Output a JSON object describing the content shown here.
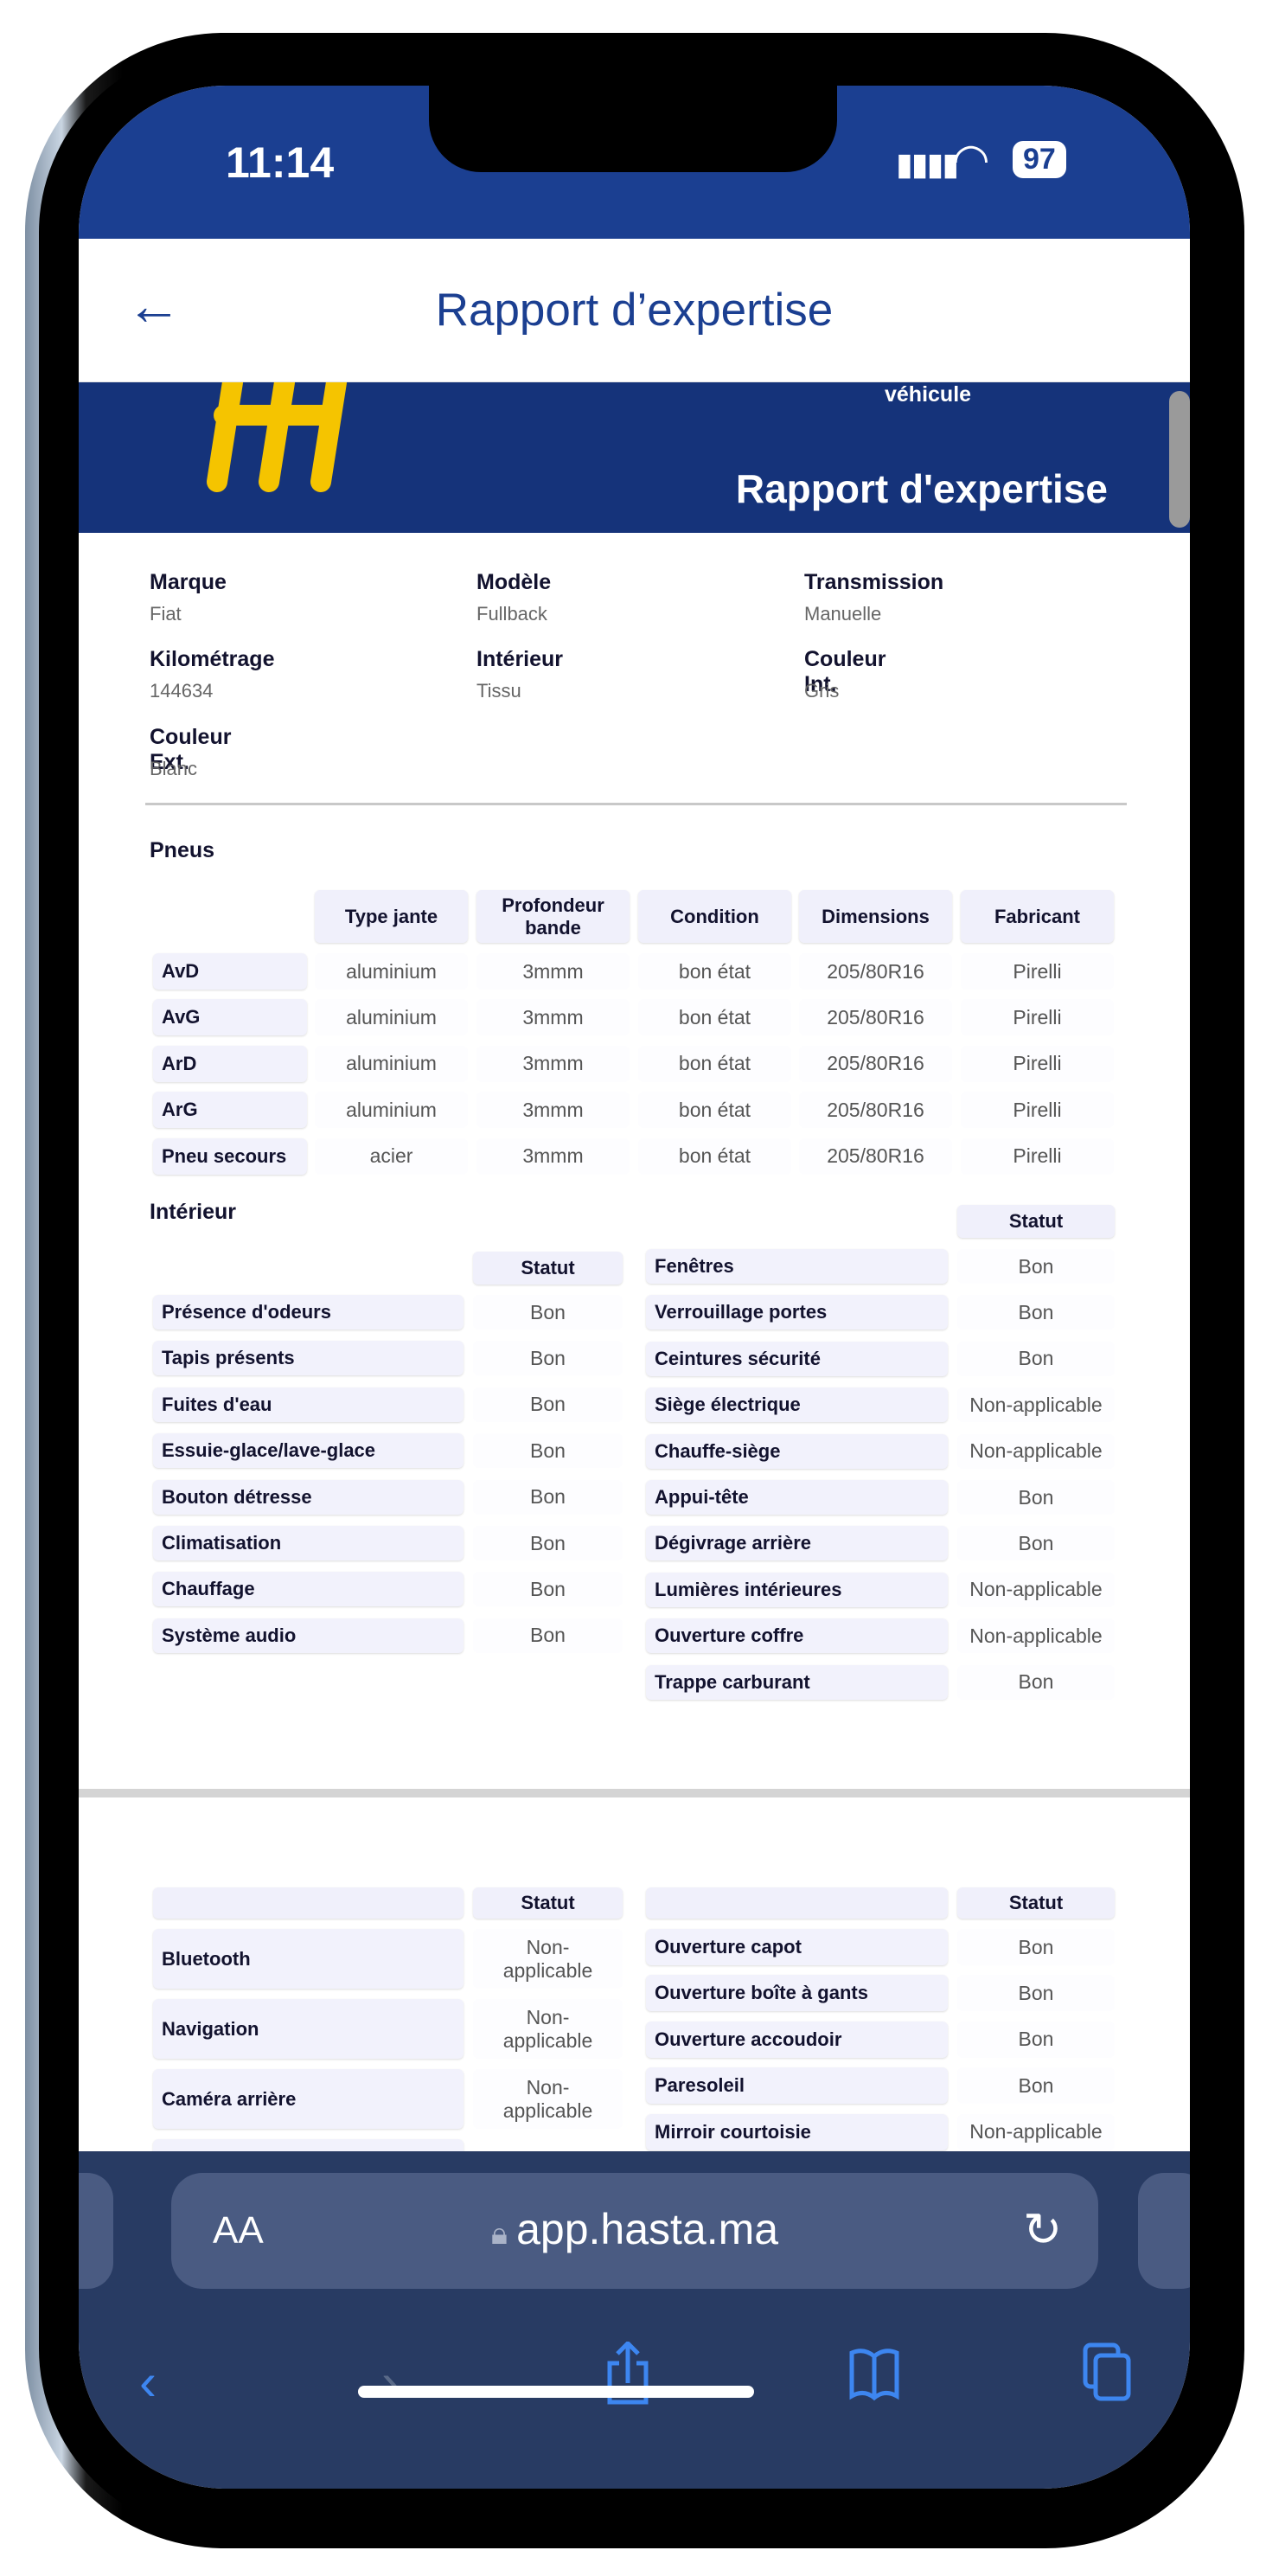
{
  "status": {
    "time": "11:14",
    "battery": "97"
  },
  "header": {
    "title": "Rapport d’expertise"
  },
  "banner": {
    "subtitle": "véhicule",
    "title": "Rapport d'expertise",
    "logo_color": "#f5c400"
  },
  "vehicle": [
    {
      "label": "Marque",
      "value": "Fiat"
    },
    {
      "label": "Modèle",
      "value": "Fullback"
    },
    {
      "label": "Transmission",
      "value": "Manuelle"
    },
    {
      "label": "Kilométrage",
      "value": "144634"
    },
    {
      "label": "Intérieur",
      "value": "Tissu"
    },
    {
      "label": "Couleur Int.",
      "value": "Gris"
    },
    {
      "label": "Couleur Ext.",
      "value": "Blanc"
    }
  ],
  "tires": {
    "title": "Pneus",
    "columns": [
      "Type jante",
      "Profondeur bande",
      "Condition",
      "Dimensions",
      "Fabricant"
    ],
    "rows": [
      {
        "name": "AvD",
        "values": [
          "aluminium",
          "3mmm",
          "bon état",
          "205/80R16",
          "Pirelli"
        ]
      },
      {
        "name": "AvG",
        "values": [
          "aluminium",
          "3mmm",
          "bon état",
          "205/80R16",
          "Pirelli"
        ]
      },
      {
        "name": "ArD",
        "values": [
          "aluminium",
          "3mmm",
          "bon état",
          "205/80R16",
          "Pirelli"
        ]
      },
      {
        "name": "ArG",
        "values": [
          "aluminium",
          "3mmm",
          "bon état",
          "205/80R16",
          "Pirelli"
        ]
      },
      {
        "name": "Pneu secours",
        "values": [
          "acier",
          "3mmm",
          "bon état",
          "205/80R16",
          "Pirelli"
        ]
      }
    ]
  },
  "interior": {
    "title": "Intérieur",
    "status_header": "Statut",
    "left": [
      [
        "Présence d'odeurs",
        "Bon"
      ],
      [
        "Tapis présents",
        "Bon"
      ],
      [
        "Fuites d'eau",
        "Bon"
      ],
      [
        "Essuie-glace/lave-glace",
        "Bon"
      ],
      [
        "Bouton détresse",
        "Bon"
      ],
      [
        "Climatisation",
        "Bon"
      ],
      [
        "Chauffage",
        "Bon"
      ],
      [
        "Système audio",
        "Bon"
      ]
    ],
    "right": [
      [
        "Fenêtres",
        "Bon"
      ],
      [
        "Verrouillage portes",
        "Bon"
      ],
      [
        "Ceintures sécurité",
        "Bon"
      ],
      [
        "Siège électrique",
        "Non-applicable"
      ],
      [
        "Chauffe-siège",
        "Non-applicable"
      ],
      [
        "Appui-tête",
        "Bon"
      ],
      [
        "Dégivrage arrière",
        "Bon"
      ],
      [
        "Lumières intérieures",
        "Non-applicable"
      ],
      [
        "Ouverture coffre",
        "Non-applicable"
      ],
      [
        "Trappe carburant",
        "Bon"
      ]
    ]
  },
  "page2": {
    "status_header": "Statut",
    "left": [
      [
        "Bluetooth",
        "Non-applicable"
      ],
      [
        "Navigation",
        "Non-applicable"
      ],
      [
        "Caméra arrière",
        "Non-applicable"
      ]
    ],
    "right": [
      [
        "Ouverture capot",
        "Bon"
      ],
      [
        "Ouverture boîte à gants",
        "Bon"
      ],
      [
        "Ouverture accoudoir",
        "Bon"
      ],
      [
        "Paresoleil",
        "Bon"
      ],
      [
        "Mirroir courtoisie",
        "Non-applicable"
      ]
    ]
  },
  "browser": {
    "text_size": "AA",
    "url": "app.hasta.ma"
  }
}
